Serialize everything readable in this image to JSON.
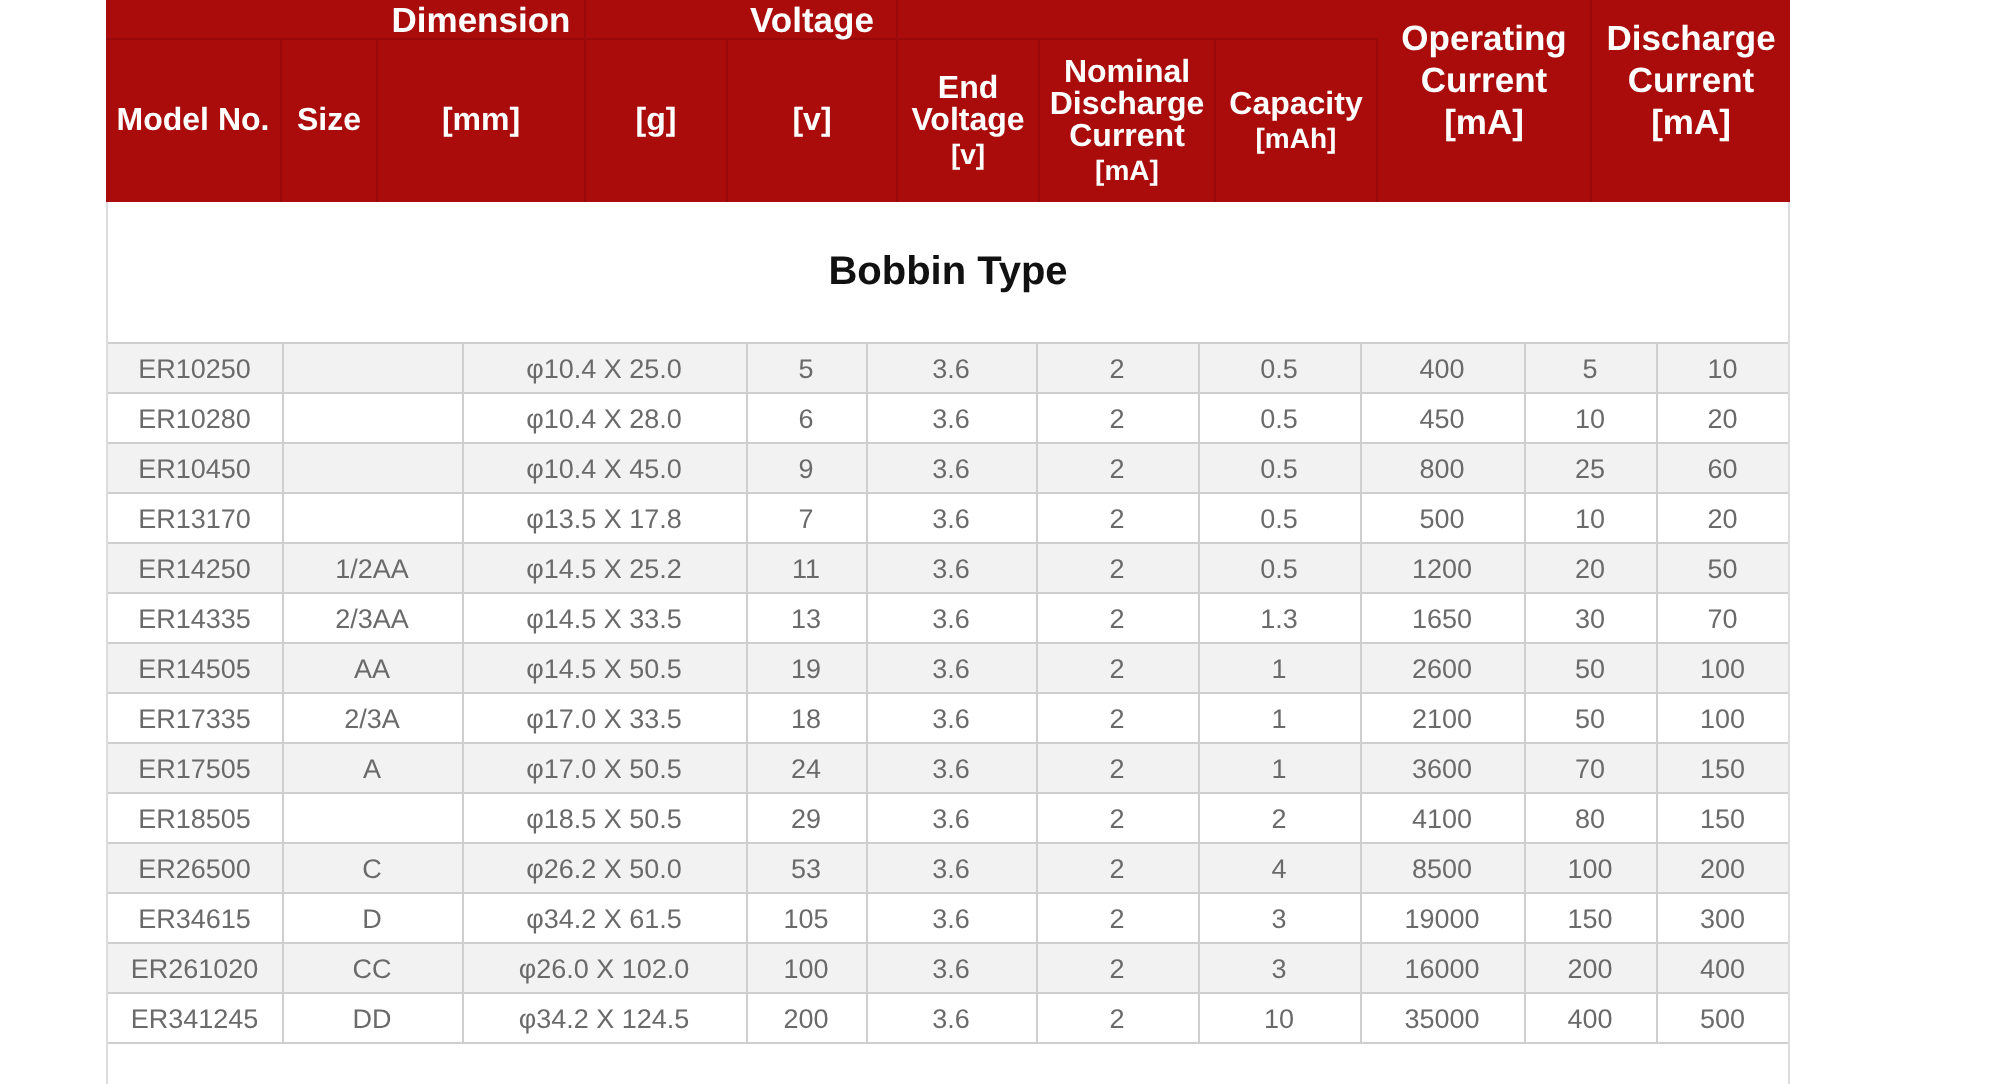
{
  "header": {
    "columns": [
      {
        "kind": "plain",
        "label": "Model No."
      },
      {
        "kind": "plain",
        "label": "Size"
      },
      {
        "kind": "plain",
        "group": "Dimension",
        "unit": "[mm]"
      },
      {
        "kind": "plain",
        "unit": "[g]"
      },
      {
        "kind": "plain",
        "group": "Voltage",
        "unit": "[v]"
      },
      {
        "kind": "stacked",
        "label": "End Voltage",
        "unit": "[v]"
      },
      {
        "kind": "stacked",
        "label": "Nominal Discharge Current",
        "unit": "[mA]"
      },
      {
        "kind": "stacked",
        "label": "Capacity",
        "unit": "[mAh]"
      },
      {
        "kind": "tall",
        "label": "Operating Current",
        "unit": "[mA]"
      },
      {
        "kind": "tall",
        "label": "Discharge Current",
        "unit": "[mA]"
      }
    ]
  },
  "section_title": "Bobbin Type",
  "rows": [
    {
      "model_no": "ER10250",
      "mm": "φ10.4 X 25.0",
      "g": "5",
      "v": "3.6",
      "end_voltage": "2",
      "nominal_discharge_current": "0.5",
      "capacity": "400",
      "operating_current": "5",
      "discharge_current": "10"
    },
    {
      "model_no": "ER10280",
      "mm": "φ10.4 X 28.0",
      "g": "6",
      "v": "3.6",
      "end_voltage": "2",
      "nominal_discharge_current": "0.5",
      "capacity": "450",
      "operating_current": "10",
      "discharge_current": "20"
    },
    {
      "model_no": "ER10450",
      "mm": "φ10.4 X 45.0",
      "g": "9",
      "v": "3.6",
      "end_voltage": "2",
      "nominal_discharge_current": "0.5",
      "capacity": "800",
      "operating_current": "25",
      "discharge_current": "60"
    },
    {
      "model_no": "ER13170",
      "mm": "φ13.5 X 17.8",
      "g": "7",
      "v": "3.6",
      "end_voltage": "2",
      "nominal_discharge_current": "0.5",
      "capacity": "500",
      "operating_current": "10",
      "discharge_current": "20"
    },
    {
      "model_no": "ER14250",
      "size": "1/2AA",
      "mm": "φ14.5 X 25.2",
      "g": "11",
      "v": "3.6",
      "end_voltage": "2",
      "nominal_discharge_current": "0.5",
      "capacity": "1200",
      "operating_current": "20",
      "discharge_current": "50"
    },
    {
      "model_no": "ER14335",
      "size": "2/3AA",
      "mm": "φ14.5 X 33.5",
      "g": "13",
      "v": "3.6",
      "end_voltage": "2",
      "nominal_discharge_current": "1.3",
      "capacity": "1650",
      "operating_current": "30",
      "discharge_current": "70"
    },
    {
      "model_no": "ER14505",
      "size": "AA",
      "mm": "φ14.5 X 50.5",
      "g": "19",
      "v": "3.6",
      "end_voltage": "2",
      "nominal_discharge_current": "1",
      "capacity": "2600",
      "operating_current": "50",
      "discharge_current": "100"
    },
    {
      "model_no": "ER17335",
      "size": "2/3A",
      "mm": "φ17.0 X 33.5",
      "g": "18",
      "v": "3.6",
      "end_voltage": "2",
      "nominal_discharge_current": "1",
      "capacity": "2100",
      "operating_current": "50",
      "discharge_current": "100"
    },
    {
      "model_no": "ER17505",
      "size": "A",
      "mm": "φ17.0 X 50.5",
      "g": "24",
      "v": "3.6",
      "end_voltage": "2",
      "nominal_discharge_current": "1",
      "capacity": "3600",
      "operating_current": "70",
      "discharge_current": "150"
    },
    {
      "model_no": "ER18505",
      "mm": "φ18.5 X 50.5",
      "g": "29",
      "v": "3.6",
      "end_voltage": "2",
      "nominal_discharge_current": "2",
      "capacity": "4100",
      "operating_current": "80",
      "discharge_current": "150"
    },
    {
      "model_no": "ER26500",
      "size": "C",
      "mm": "φ26.2 X 50.0",
      "g": "53",
      "v": "3.6",
      "end_voltage": "2",
      "nominal_discharge_current": "4",
      "capacity": "8500",
      "operating_current": "100",
      "discharge_current": "200"
    },
    {
      "model_no": "ER34615",
      "size": "D",
      "mm": "φ34.2 X 61.5",
      "g": "105",
      "v": "3.6",
      "end_voltage": "2",
      "nominal_discharge_current": "3",
      "capacity": "19000",
      "operating_current": "150",
      "discharge_current": "300"
    },
    {
      "model_no": "ER261020",
      "size": "CC",
      "mm": "φ26.0 X 102.0",
      "g": "100",
      "v": "3.6",
      "end_voltage": "2",
      "nominal_discharge_current": "3",
      "capacity": "16000",
      "operating_current": "200",
      "discharge_current": "400"
    },
    {
      "model_no": "ER341245",
      "size": "DD",
      "mm": "φ34.2 X 124.5",
      "g": "200",
      "v": "3.6",
      "end_voltage": "2",
      "nominal_discharge_current": "10",
      "capacity": "35000",
      "operating_current": "400",
      "discharge_current": "500"
    }
  ]
}
